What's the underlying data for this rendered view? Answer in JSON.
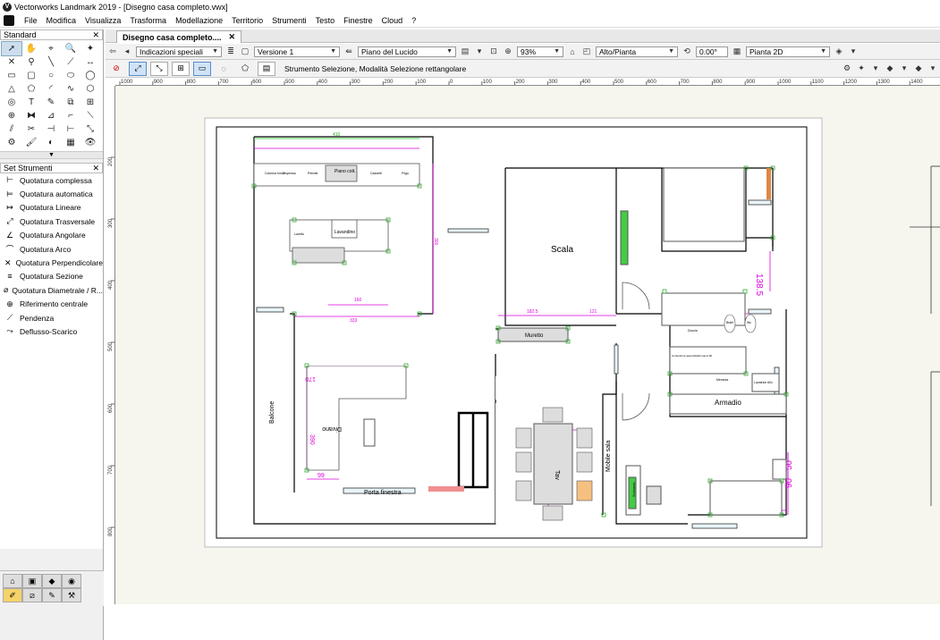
{
  "window": {
    "title": "Vectorworks Landmark 2019 - [Disegno casa completo.vwx]"
  },
  "menu": [
    "File",
    "Modifica",
    "Visualizza",
    "Trasforma",
    "Modellazione",
    "Territorio",
    "Strumenti",
    "Testo",
    "Finestre",
    "Cloud",
    "?"
  ],
  "standard_palette": {
    "title": "Standard",
    "close": "✕"
  },
  "toolset": {
    "title": "Set Strumenti",
    "close": "✕",
    "items": [
      "Quotatura complessa",
      "Quotatura automatica",
      "Quotatura Lineare",
      "Quotatura Trasversale",
      "Quotatura Angolare",
      "Quotatura Arco",
      "Quotatura Perpendicolare",
      "Quotatura Sezione",
      "Quotatura Diametrale / R...",
      "Riferimento centrale",
      "Pendenza",
      "Deflusso-Scarico"
    ]
  },
  "document_tab": {
    "label": "Disegno casa completo....",
    "close": "✕"
  },
  "viewbar": {
    "class_select": "Indicazioni speciali",
    "version_select": "Versione 1",
    "layer_select": "Piano del Lucido",
    "zoom": "93%",
    "view_select": "Alto/Pianta",
    "rotation": "0.00°",
    "render_select": "Pianta 2D"
  },
  "modebar": {
    "status_text": "Strumento Selezione, Modalità Selezione rettangolare"
  },
  "ruler": {
    "h_ticks": [
      "1000",
      "900",
      "800",
      "700",
      "600",
      "500",
      "400",
      "300",
      "200",
      "100",
      "0",
      "100",
      "200",
      "300",
      "400",
      "500",
      "600",
      "700",
      "800",
      "900",
      "1000",
      "1100",
      "1200",
      "1300",
      "1400",
      "1500"
    ],
    "v_ticks": [
      "200",
      "300",
      "400",
      "500",
      "600",
      "700",
      "800"
    ]
  },
  "drawing": {
    "dims": {
      "top_width": "410",
      "top_height": "300",
      "bottom_width": "333",
      "mid_160": "160",
      "muretto_w": "182.5",
      "passage_w": "121",
      "bath_w": "202",
      "bath_h": "138.5",
      "bed_w": "200",
      "bed_h": "90",
      "side_50": "50",
      "table_w": "100",
      "table_l": "270",
      "sofa_l": "170",
      "sofa_h": "390",
      "sofa_w": "99"
    },
    "labels": {
      "scala": "Scala",
      "muretto": "Muretto",
      "armadio": "Armadio",
      "balcone": "Balcone",
      "porta_finestra": "Porta finestra",
      "mobile_sala": "Mobile sala",
      "tav": "Tav",
      "lavandino": "Lavandino",
      "piano_cott": "Piano cott.",
      "divano": "Divano",
      "scrivania": "Scrivania",
      "lavatrice": "Lavatrice 60x",
      "doccia": "Doccia",
      "bidet": "Bidet",
      "wc": "Wc",
      "frigorifero": "Frigo",
      "colonna_forno": "Colonna forno",
      "dispensa": "Dispensa",
      "pensile": "Pensile",
      "cassetti": "Cassetti",
      "lavello": "Lavello",
      "contenitore": "Contenitore appendiabiti sopra 90",
      "mensola": "Mensola",
      "parete": "Parete"
    }
  }
}
